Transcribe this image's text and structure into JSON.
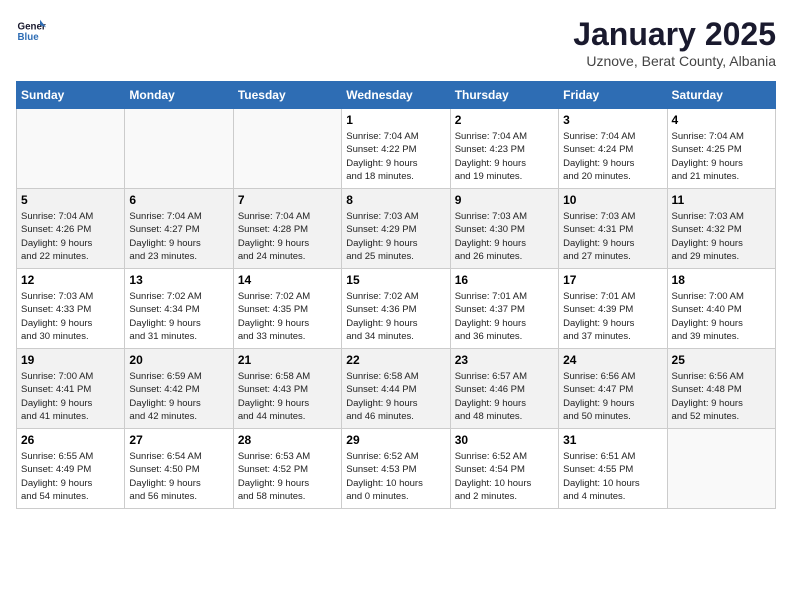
{
  "header": {
    "logo_general": "General",
    "logo_blue": "Blue",
    "month_year": "January 2025",
    "location": "Uznove, Berat County, Albania"
  },
  "days_of_week": [
    "Sunday",
    "Monday",
    "Tuesday",
    "Wednesday",
    "Thursday",
    "Friday",
    "Saturday"
  ],
  "weeks": [
    [
      {
        "day": "",
        "info": ""
      },
      {
        "day": "",
        "info": ""
      },
      {
        "day": "",
        "info": ""
      },
      {
        "day": "1",
        "info": "Sunrise: 7:04 AM\nSunset: 4:22 PM\nDaylight: 9 hours\nand 18 minutes."
      },
      {
        "day": "2",
        "info": "Sunrise: 7:04 AM\nSunset: 4:23 PM\nDaylight: 9 hours\nand 19 minutes."
      },
      {
        "day": "3",
        "info": "Sunrise: 7:04 AM\nSunset: 4:24 PM\nDaylight: 9 hours\nand 20 minutes."
      },
      {
        "day": "4",
        "info": "Sunrise: 7:04 AM\nSunset: 4:25 PM\nDaylight: 9 hours\nand 21 minutes."
      }
    ],
    [
      {
        "day": "5",
        "info": "Sunrise: 7:04 AM\nSunset: 4:26 PM\nDaylight: 9 hours\nand 22 minutes."
      },
      {
        "day": "6",
        "info": "Sunrise: 7:04 AM\nSunset: 4:27 PM\nDaylight: 9 hours\nand 23 minutes."
      },
      {
        "day": "7",
        "info": "Sunrise: 7:04 AM\nSunset: 4:28 PM\nDaylight: 9 hours\nand 24 minutes."
      },
      {
        "day": "8",
        "info": "Sunrise: 7:03 AM\nSunset: 4:29 PM\nDaylight: 9 hours\nand 25 minutes."
      },
      {
        "day": "9",
        "info": "Sunrise: 7:03 AM\nSunset: 4:30 PM\nDaylight: 9 hours\nand 26 minutes."
      },
      {
        "day": "10",
        "info": "Sunrise: 7:03 AM\nSunset: 4:31 PM\nDaylight: 9 hours\nand 27 minutes."
      },
      {
        "day": "11",
        "info": "Sunrise: 7:03 AM\nSunset: 4:32 PM\nDaylight: 9 hours\nand 29 minutes."
      }
    ],
    [
      {
        "day": "12",
        "info": "Sunrise: 7:03 AM\nSunset: 4:33 PM\nDaylight: 9 hours\nand 30 minutes."
      },
      {
        "day": "13",
        "info": "Sunrise: 7:02 AM\nSunset: 4:34 PM\nDaylight: 9 hours\nand 31 minutes."
      },
      {
        "day": "14",
        "info": "Sunrise: 7:02 AM\nSunset: 4:35 PM\nDaylight: 9 hours\nand 33 minutes."
      },
      {
        "day": "15",
        "info": "Sunrise: 7:02 AM\nSunset: 4:36 PM\nDaylight: 9 hours\nand 34 minutes."
      },
      {
        "day": "16",
        "info": "Sunrise: 7:01 AM\nSunset: 4:37 PM\nDaylight: 9 hours\nand 36 minutes."
      },
      {
        "day": "17",
        "info": "Sunrise: 7:01 AM\nSunset: 4:39 PM\nDaylight: 9 hours\nand 37 minutes."
      },
      {
        "day": "18",
        "info": "Sunrise: 7:00 AM\nSunset: 4:40 PM\nDaylight: 9 hours\nand 39 minutes."
      }
    ],
    [
      {
        "day": "19",
        "info": "Sunrise: 7:00 AM\nSunset: 4:41 PM\nDaylight: 9 hours\nand 41 minutes."
      },
      {
        "day": "20",
        "info": "Sunrise: 6:59 AM\nSunset: 4:42 PM\nDaylight: 9 hours\nand 42 minutes."
      },
      {
        "day": "21",
        "info": "Sunrise: 6:58 AM\nSunset: 4:43 PM\nDaylight: 9 hours\nand 44 minutes."
      },
      {
        "day": "22",
        "info": "Sunrise: 6:58 AM\nSunset: 4:44 PM\nDaylight: 9 hours\nand 46 minutes."
      },
      {
        "day": "23",
        "info": "Sunrise: 6:57 AM\nSunset: 4:46 PM\nDaylight: 9 hours\nand 48 minutes."
      },
      {
        "day": "24",
        "info": "Sunrise: 6:56 AM\nSunset: 4:47 PM\nDaylight: 9 hours\nand 50 minutes."
      },
      {
        "day": "25",
        "info": "Sunrise: 6:56 AM\nSunset: 4:48 PM\nDaylight: 9 hours\nand 52 minutes."
      }
    ],
    [
      {
        "day": "26",
        "info": "Sunrise: 6:55 AM\nSunset: 4:49 PM\nDaylight: 9 hours\nand 54 minutes."
      },
      {
        "day": "27",
        "info": "Sunrise: 6:54 AM\nSunset: 4:50 PM\nDaylight: 9 hours\nand 56 minutes."
      },
      {
        "day": "28",
        "info": "Sunrise: 6:53 AM\nSunset: 4:52 PM\nDaylight: 9 hours\nand 58 minutes."
      },
      {
        "day": "29",
        "info": "Sunrise: 6:52 AM\nSunset: 4:53 PM\nDaylight: 10 hours\nand 0 minutes."
      },
      {
        "day": "30",
        "info": "Sunrise: 6:52 AM\nSunset: 4:54 PM\nDaylight: 10 hours\nand 2 minutes."
      },
      {
        "day": "31",
        "info": "Sunrise: 6:51 AM\nSunset: 4:55 PM\nDaylight: 10 hours\nand 4 minutes."
      },
      {
        "day": "",
        "info": ""
      }
    ]
  ]
}
